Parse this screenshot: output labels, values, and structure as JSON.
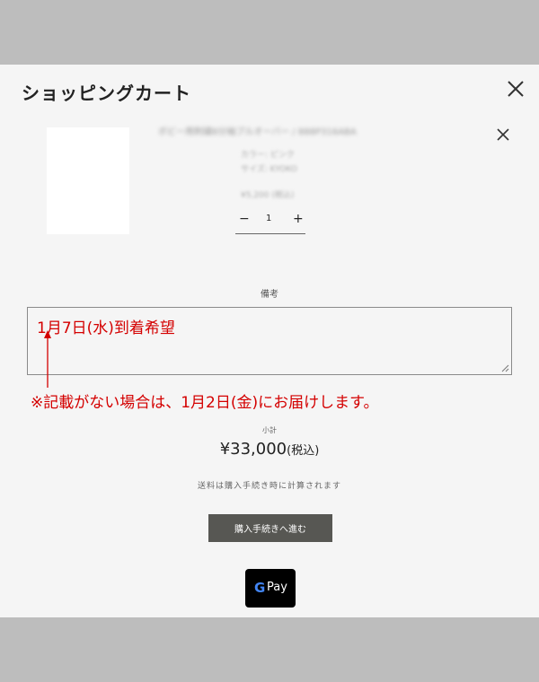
{
  "cart": {
    "title": "ショッピングカート",
    "close_icon": "close-icon"
  },
  "item": {
    "name": "ボビー用刺繍8分袖プルオーバー / 888P316ABA",
    "option1": "カラー: ピンク",
    "option2": "サイズ: KYOKO",
    "price": "¥5,200 (税込)",
    "quantity": "1",
    "minus": "−",
    "plus": "+"
  },
  "note": {
    "label": "備考",
    "value": "1月7日(水)到着希望"
  },
  "annotation": "※記載がない場合は、1月2日(金)にお届けします。",
  "summary": {
    "subtotal_label": "小計",
    "amount": "¥33,000",
    "tax": "(税込)",
    "shipping_note": "送料は購入手続き時に計算されます"
  },
  "checkout_label": "購入手続きへ進む",
  "gpay": {
    "g": "G",
    "pay": "Pay"
  },
  "colors": {
    "annotation": "#d40000",
    "checkout_bg": "#575753",
    "backdrop": "#bdbdbd",
    "panel": "#f5f5f5"
  }
}
